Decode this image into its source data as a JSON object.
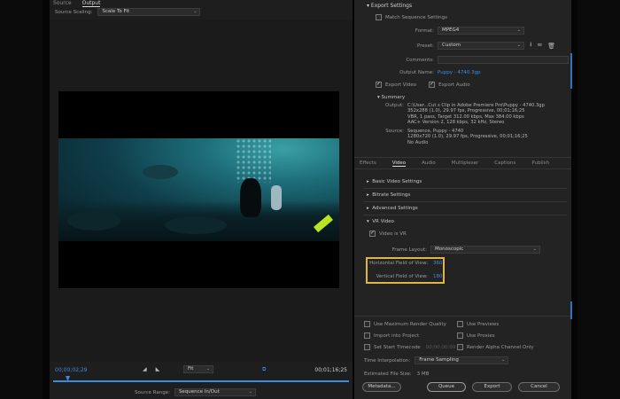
{
  "left_panel": {
    "tabs": [
      "Source",
      "Output"
    ],
    "source_scaling_label": "Source Scaling:",
    "source_scaling_value": "Scale To Fit",
    "timecode_in": "00;00;02;29",
    "timecode_out": "00;01;16;25",
    "zoom_value": "Fit",
    "source_range_label": "Source Range:",
    "source_range_value": "Sequence In/Out"
  },
  "export": {
    "header": "Export Settings",
    "match_sequence_label": "Match Sequence Settings",
    "format_label": "Format:",
    "format_value": "MPEG4",
    "preset_label": "Preset:",
    "preset_value": "Custom",
    "comments_label": "Comments:",
    "comments_value": "",
    "output_name_label": "Output Name:",
    "output_name_value": "Puppy - 4740.3gp",
    "export_video_label": "Export Video",
    "export_audio_label": "Export Audio",
    "summary_label": "Summary",
    "summary_output_label": "Output:",
    "summary_output_lines": [
      "C:\\User...Cut s Clip in Adobe Premiere Pro\\Puppy - 4740.3gp",
      "352x288 (1.0), 29.97 fps, Progressive, 00;01;16;25",
      "VBR, 1 pass, Target 312.00 kbps, Max 384.00 kbps",
      "AAC+ Version 2, 128 kbps, 32 kHz, Stereo"
    ],
    "summary_source_label": "Source:",
    "summary_source_lines": [
      "Sequence, Puppy - 4740",
      "1280x720 (1.0), 29.97 fps, Progressive, 00;01;16;25",
      "No Audio"
    ]
  },
  "sub_tabs": [
    "Effects",
    "Video",
    "Audio",
    "Multiplexer",
    "Captions",
    "Publish"
  ],
  "sections": {
    "basic_video": "Basic Video Settings",
    "bitrate": "Bitrate Settings",
    "advanced": "Advanced Settings",
    "vr_video": "VR Video",
    "video_is_vr": "Video is VR",
    "frame_layout_label": "Frame Layout:",
    "frame_layout_value": "Monoscopic",
    "hfov_label": "Horizontal Field of View:",
    "hfov_value": "360",
    "vfov_label": "Vertical Field of View:",
    "vfov_value": "180"
  },
  "bottom_options": {
    "max_render": "Use Maximum Render Quality",
    "use_previews": "Use Previews",
    "import_project": "Import into Project",
    "use_proxies": "Use Proxies",
    "set_start_tc": "Set Start Timecode",
    "start_tc_value": "00;00;00;00",
    "render_alpha": "Render Alpha Channel Only",
    "time_interp_label": "Time Interpolation:",
    "time_interp_value": "Frame Sampling",
    "est_size_label": "Estimated File Size:",
    "est_size_value": "3 MB"
  },
  "buttons": {
    "metadata": "Metadata...",
    "queue": "Queue",
    "export": "Export",
    "cancel": "Cancel"
  },
  "colors": {
    "accent": "#3d8ce0",
    "highlight": "#e1b34a"
  }
}
